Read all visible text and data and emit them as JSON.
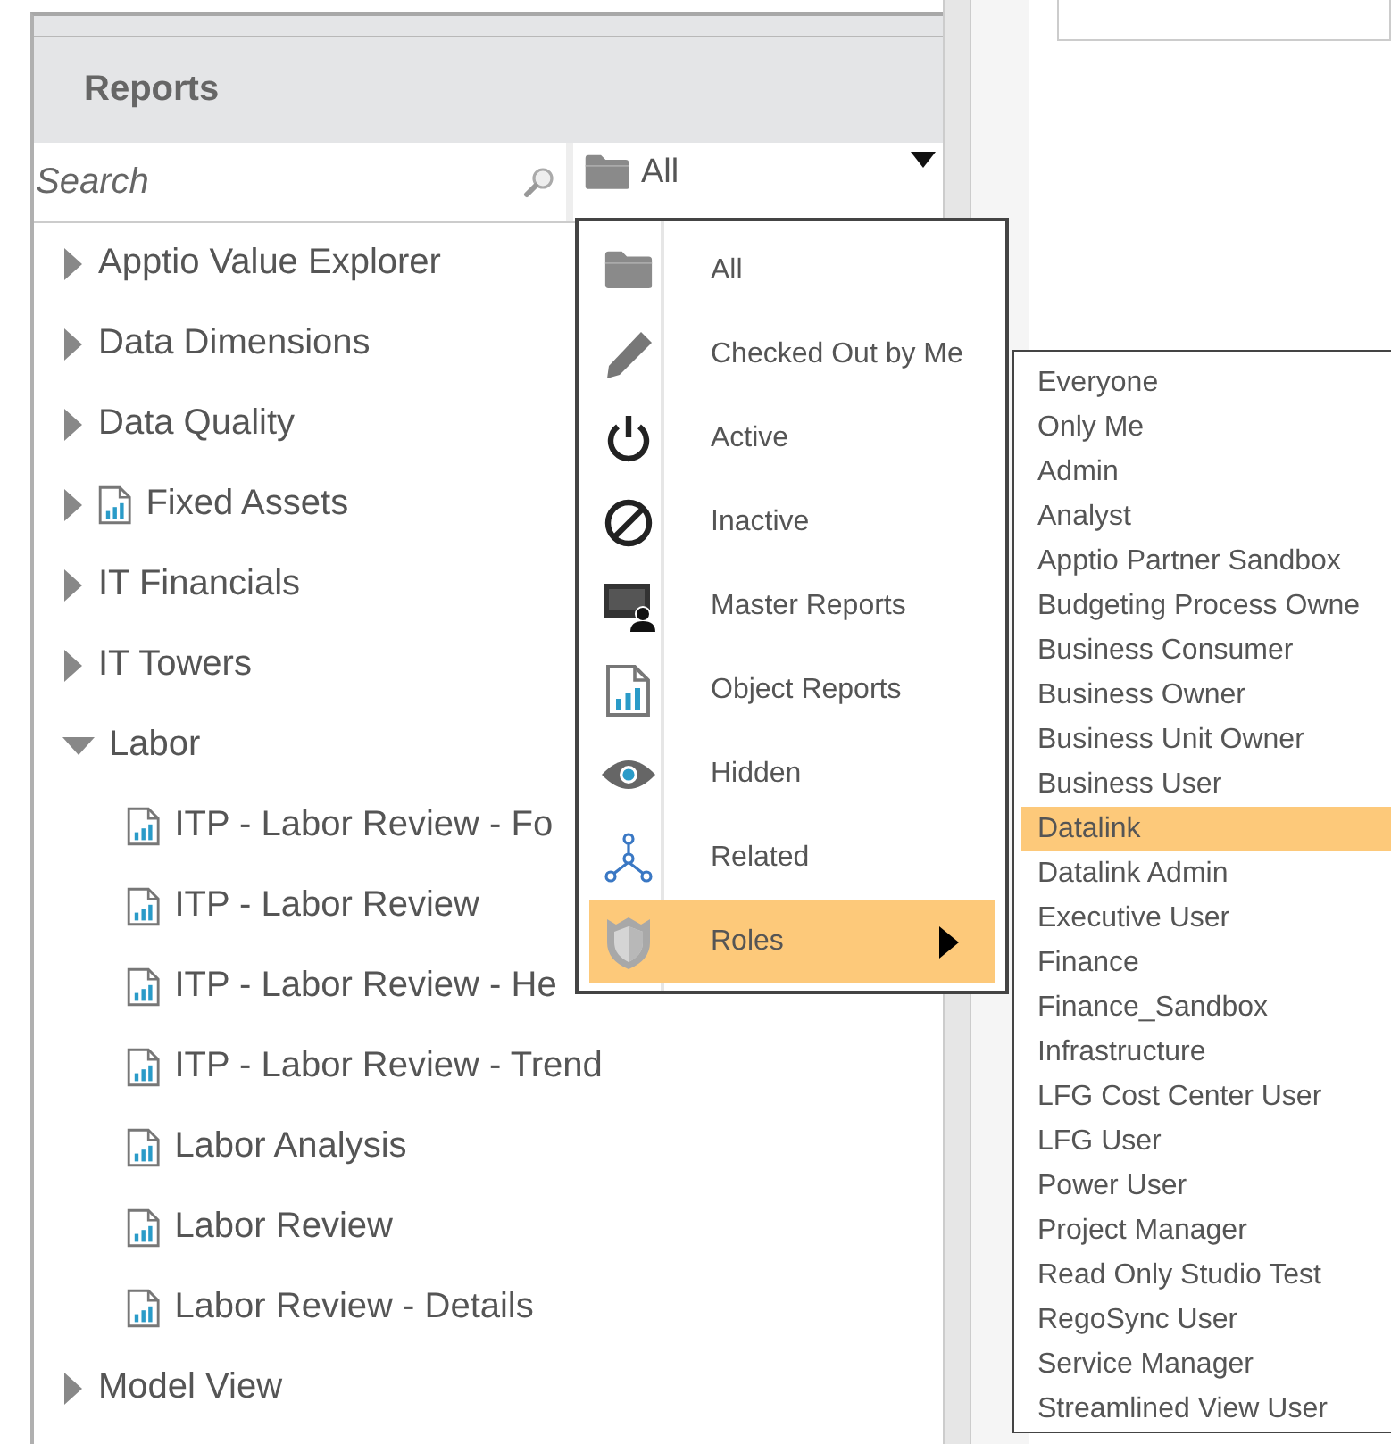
{
  "panel": {
    "title": "Reports"
  },
  "search": {
    "placeholder": "Search"
  },
  "filter": {
    "value": "All"
  },
  "tree": [
    {
      "label": "Apptio Value Explorer",
      "kind": "folder",
      "expanded": false
    },
    {
      "label": "Data Dimensions",
      "kind": "folder",
      "expanded": false
    },
    {
      "label": "Data Quality",
      "kind": "folder",
      "expanded": false
    },
    {
      "label": "Fixed Assets",
      "kind": "report-folder",
      "expanded": false
    },
    {
      "label": "IT Financials",
      "kind": "folder",
      "expanded": false
    },
    {
      "label": "IT Towers",
      "kind": "folder",
      "expanded": false
    },
    {
      "label": "Labor",
      "kind": "folder",
      "expanded": true,
      "children": [
        {
          "label": "ITP - Labor Review - Fo",
          "kind": "report"
        },
        {
          "label": "ITP - Labor Review",
          "kind": "report"
        },
        {
          "label": "ITP - Labor Review - He",
          "kind": "report"
        },
        {
          "label": "ITP - Labor Review - Trend",
          "kind": "report"
        },
        {
          "label": "Labor Analysis",
          "kind": "report"
        },
        {
          "label": "Labor Review",
          "kind": "report"
        },
        {
          "label": "Labor Review - Details",
          "kind": "report"
        }
      ]
    },
    {
      "label": "Model View",
      "kind": "folder",
      "expanded": false
    }
  ],
  "filter_menu": [
    {
      "label": "All",
      "selected": false,
      "has_submenu": false
    },
    {
      "label": "Checked Out by Me",
      "selected": false,
      "has_submenu": false
    },
    {
      "label": "Active",
      "selected": false,
      "has_submenu": false
    },
    {
      "label": "Inactive",
      "selected": false,
      "has_submenu": false
    },
    {
      "label": "Master Reports",
      "selected": false,
      "has_submenu": false
    },
    {
      "label": "Object Reports",
      "selected": false,
      "has_submenu": false
    },
    {
      "label": "Hidden",
      "selected": false,
      "has_submenu": false
    },
    {
      "label": "Related",
      "selected": false,
      "has_submenu": false
    },
    {
      "label": "Roles",
      "selected": true,
      "has_submenu": true
    }
  ],
  "roles_menu": [
    {
      "label": "Everyone",
      "selected": false
    },
    {
      "label": "Only Me",
      "selected": false
    },
    {
      "label": "Admin",
      "selected": false
    },
    {
      "label": "Analyst",
      "selected": false
    },
    {
      "label": "Apptio Partner Sandbox",
      "selected": false
    },
    {
      "label": "Budgeting Process Owne",
      "selected": false
    },
    {
      "label": "Business Consumer",
      "selected": false
    },
    {
      "label": "Business Owner",
      "selected": false
    },
    {
      "label": "Business Unit Owner",
      "selected": false
    },
    {
      "label": "Business User",
      "selected": false
    },
    {
      "label": "Datalink",
      "selected": true
    },
    {
      "label": "Datalink Admin",
      "selected": false
    },
    {
      "label": "Executive User",
      "selected": false
    },
    {
      "label": "Finance",
      "selected": false
    },
    {
      "label": "Finance_Sandbox",
      "selected": false
    },
    {
      "label": "Infrastructure",
      "selected": false
    },
    {
      "label": "LFG Cost Center User",
      "selected": false
    },
    {
      "label": "LFG User",
      "selected": false
    },
    {
      "label": "Power User",
      "selected": false
    },
    {
      "label": "Project Manager",
      "selected": false
    },
    {
      "label": "Read Only Studio Test",
      "selected": false
    },
    {
      "label": "RegoSync User",
      "selected": false
    },
    {
      "label": "Service Manager",
      "selected": false
    },
    {
      "label": "Streamlined View User",
      "selected": false
    }
  ]
}
